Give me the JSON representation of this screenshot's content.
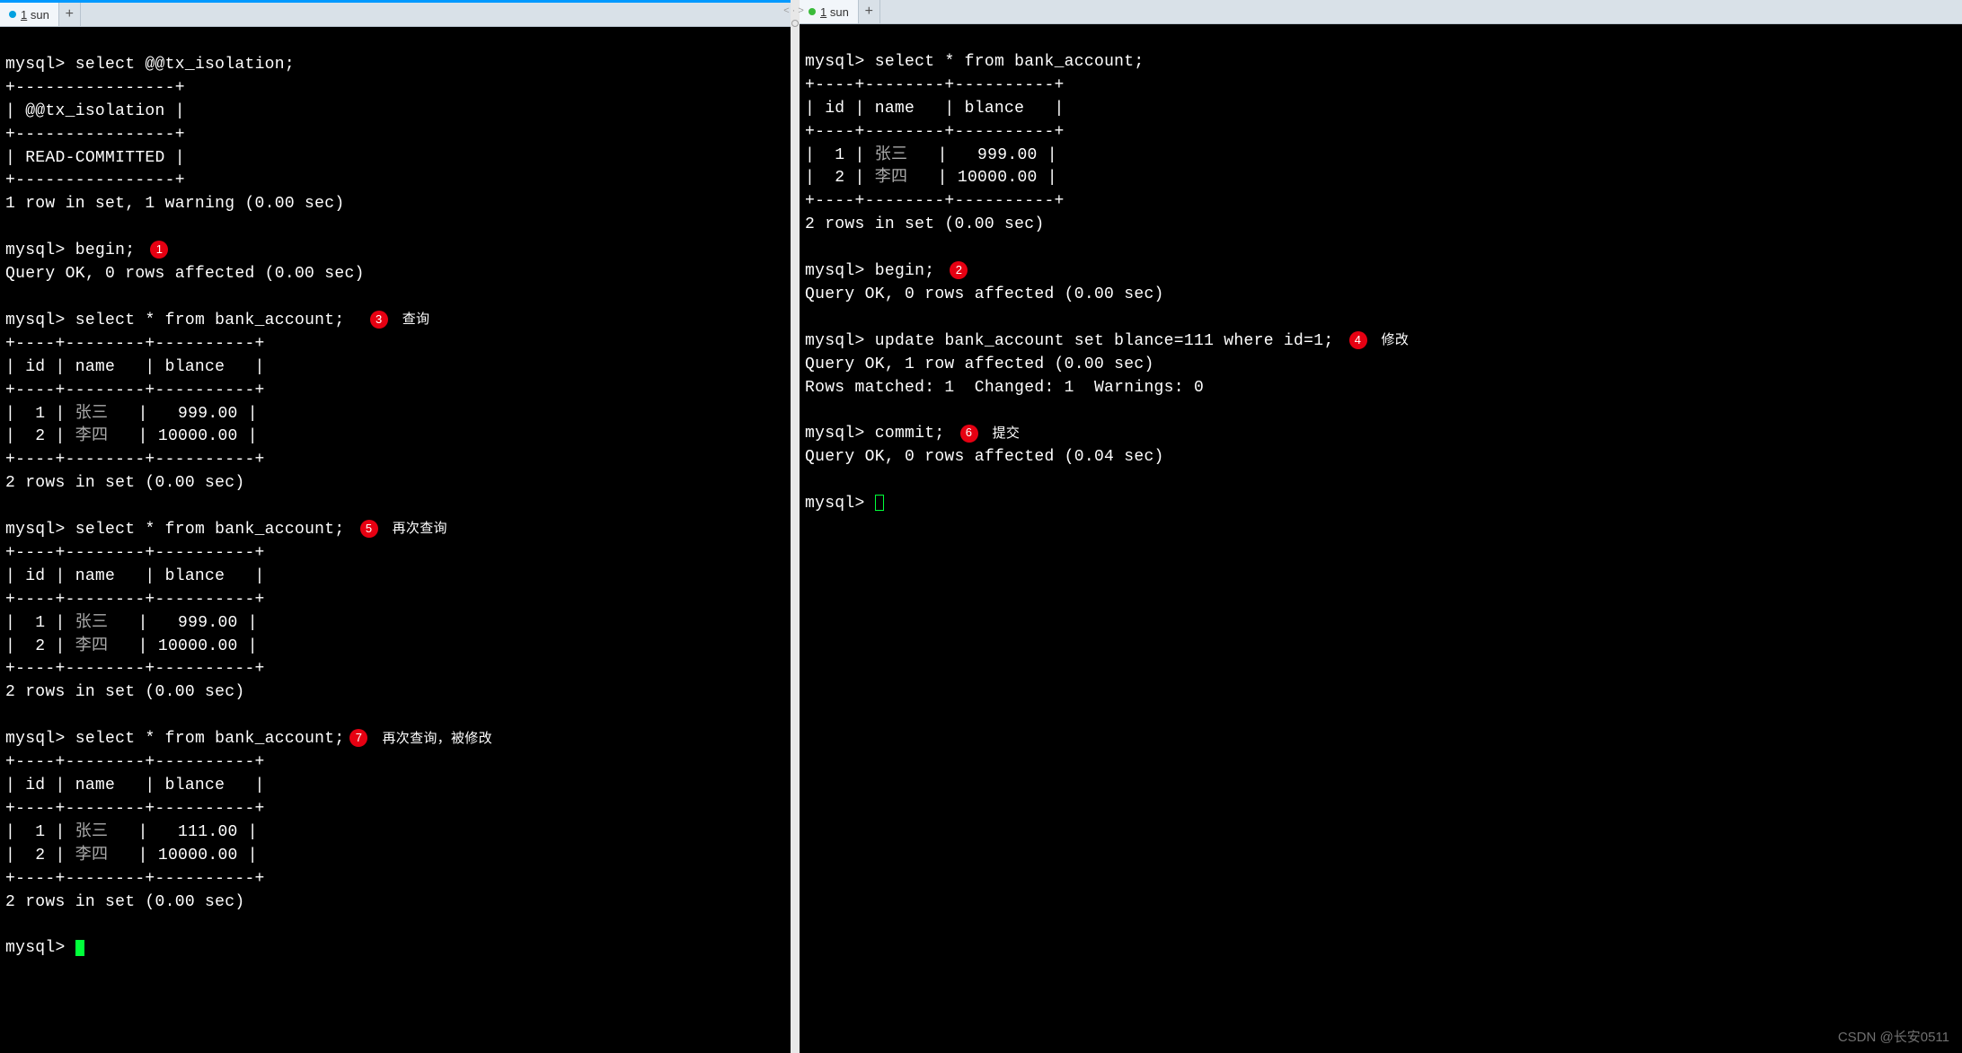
{
  "tabs": {
    "left_label": "1 sun",
    "right_label": "1 sun"
  },
  "left": {
    "prompt": "mysql>",
    "q_isolation": "select @@tx_isolation;",
    "border_iso": "+----------------+",
    "hdr_iso": "| @@tx_isolation |",
    "row_iso": "| READ-COMMITTED |",
    "result_iso": "1 row in set, 1 warning (0.00 sec)",
    "begin": "begin;",
    "begin_result": "Query OK, 0 rows affected (0.00 sec)",
    "q_select": "select * from bank_account;",
    "border_acct": "+----+--------+----------+",
    "hdr_acct": "| id | name   | blance   |",
    "row1_a": "|  1 | 张三   |   999.00 |",
    "row2_a": "|  2 | 李四   | 10000.00 |",
    "rows_result": "2 rows in set (0.00 sec)",
    "row1_c": "|  1 | 张三   |   111.00 |",
    "annotations": {
      "a1": "1",
      "a3": "3",
      "a3_text": "查询",
      "a5": "5",
      "a5_text": "再次查询",
      "a7": "7",
      "a7_text": "再次查询，被修改"
    }
  },
  "right": {
    "prompt": "mysql>",
    "q_select": "select * from bank_account;",
    "border_acct": "+----+--------+----------+",
    "hdr_acct": "| id | name   | blance   |",
    "row1": "|  1 | 张三   |   999.00 |",
    "row2": "|  2 | 李四   | 10000.00 |",
    "rows_result": "2 rows in set (0.00 sec)",
    "begin": "begin;",
    "begin_result": "Query OK, 0 rows affected (0.00 sec)",
    "q_update": "update bank_account set blance=111 where id=1;",
    "update_result1": "Query OK, 1 row affected (0.00 sec)",
    "update_result2": "Rows matched: 1  Changed: 1  Warnings: 0",
    "commit": "commit;",
    "commit_result": "Query OK, 0 rows affected (0.04 sec)",
    "annotations": {
      "a2": "2",
      "a4": "4",
      "a4_text": "修改",
      "a6": "6",
      "a6_text": "提交"
    }
  },
  "watermark": "CSDN @长安0511"
}
